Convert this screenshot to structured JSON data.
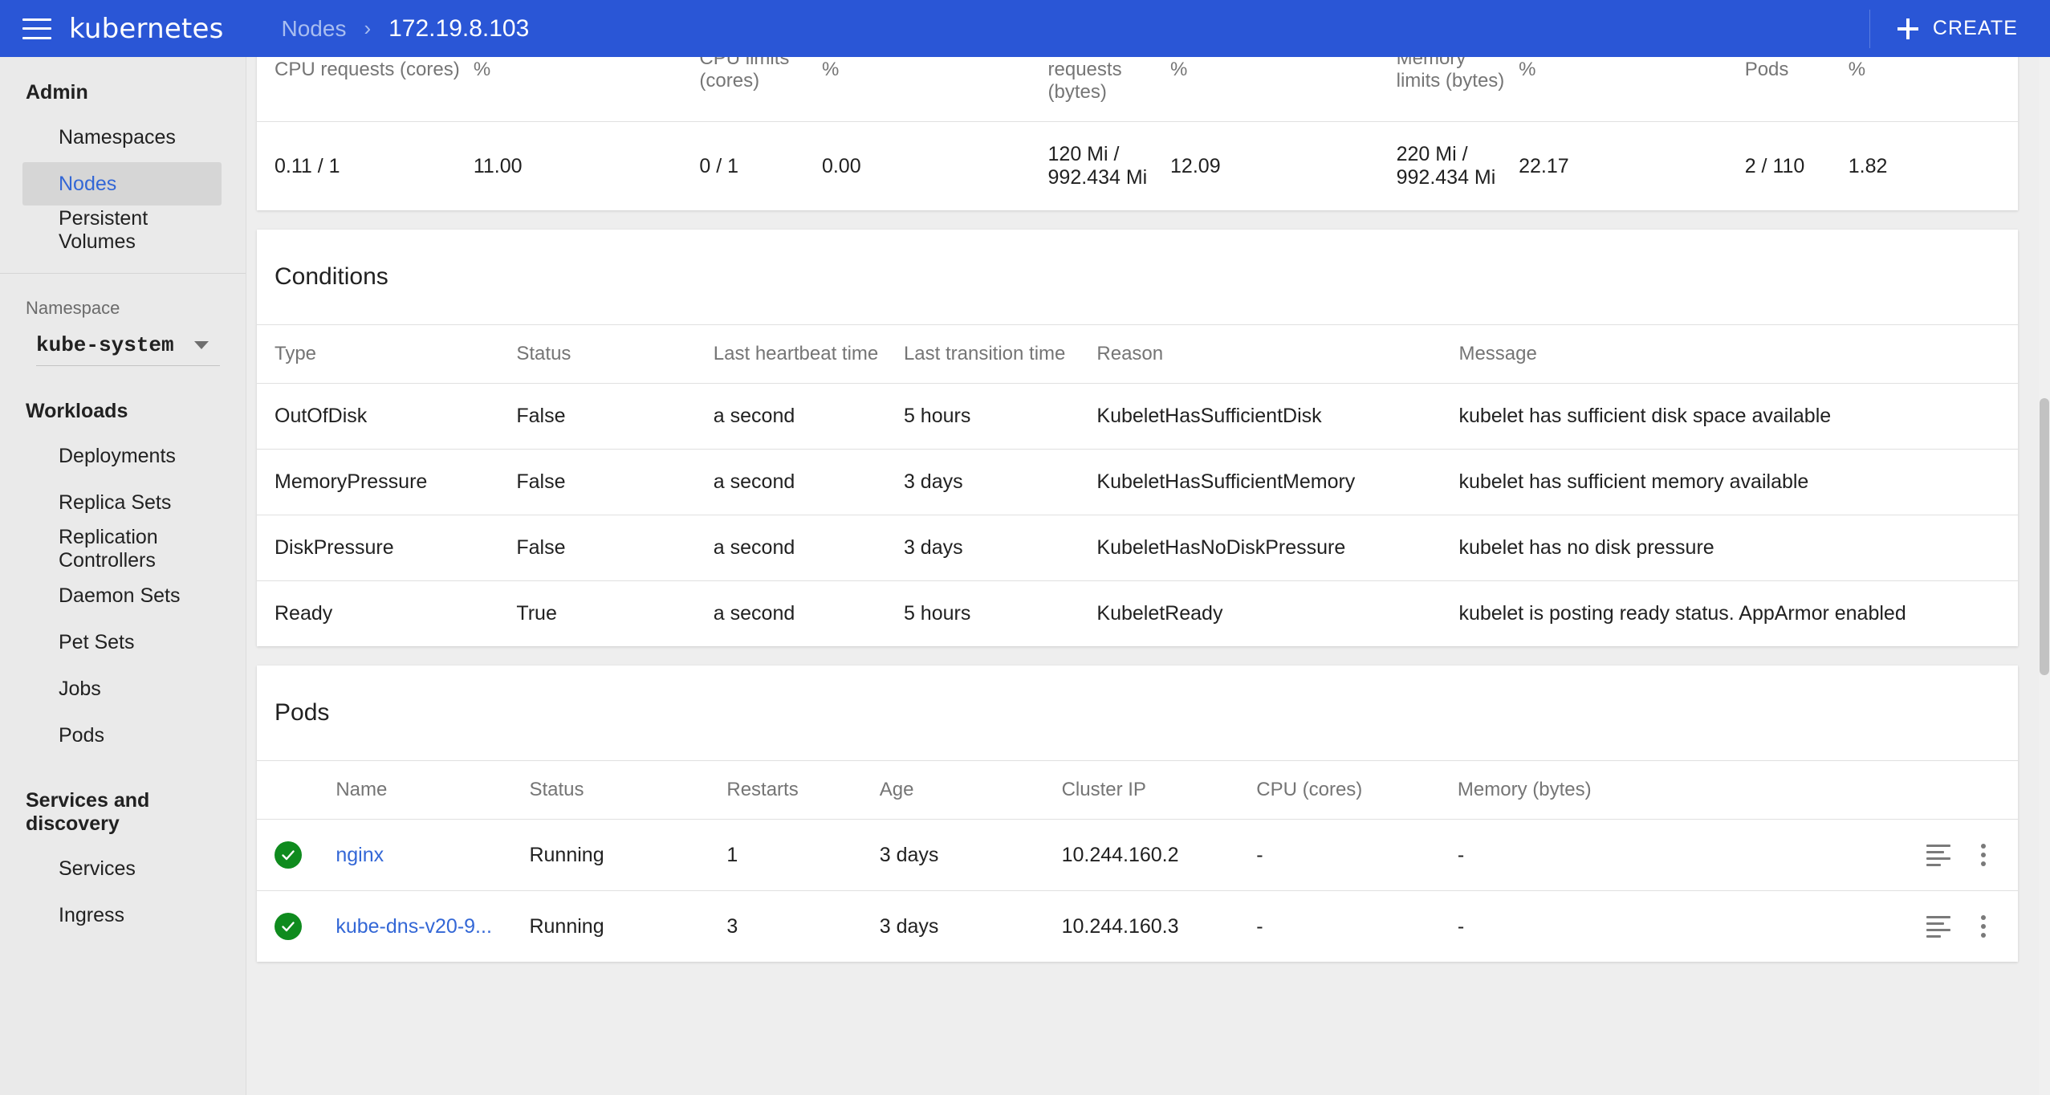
{
  "topbar": {
    "brand": "kubernetes",
    "menu_icon": "hamburger-icon",
    "breadcrumb_parent": "Nodes",
    "breadcrumb_sep": "›",
    "breadcrumb_current": "172.19.8.103",
    "create_label": "CREATE",
    "accent_color": "#2a56d6"
  },
  "sidebar": {
    "admin_title": "Admin",
    "admin_items": [
      {
        "label": "Namespaces",
        "selected": false
      },
      {
        "label": "Nodes",
        "selected": true
      },
      {
        "label": "Persistent Volumes",
        "selected": false
      }
    ],
    "namespace_label": "Namespace",
    "namespace_value": "kube-system",
    "workloads_title": "Workloads",
    "workload_items": [
      {
        "label": "Deployments"
      },
      {
        "label": "Replica Sets"
      },
      {
        "label": "Replication Controllers"
      },
      {
        "label": "Daemon Sets"
      },
      {
        "label": "Pet Sets"
      },
      {
        "label": "Jobs"
      },
      {
        "label": "Pods"
      }
    ],
    "services_title": "Services and discovery",
    "service_items": [
      {
        "label": "Services"
      },
      {
        "label": "Ingress"
      }
    ]
  },
  "metrics": {
    "headers": [
      "CPU requests (cores)",
      "%",
      "CPU limits (cores)",
      "%",
      "Memory requests (bytes)",
      "%",
      "Memory limits (bytes)",
      "%",
      "Pods",
      "%"
    ],
    "row": [
      "0.11 / 1",
      "11.00",
      "0 / 1",
      "0.00",
      "120 Mi / 992.434 Mi",
      "12.09",
      "220 Mi / 992.434 Mi",
      "22.17",
      "2 / 110",
      "1.82"
    ]
  },
  "conditions": {
    "title": "Conditions",
    "headers": [
      "Type",
      "Status",
      "Last heartbeat time",
      "Last transition time",
      "Reason",
      "Message"
    ],
    "rows": [
      {
        "type": "OutOfDisk",
        "status": "False",
        "heartbeat": "a second",
        "transition": "5 hours",
        "reason": "KubeletHasSufficientDisk",
        "message": "kubelet has sufficient disk space available"
      },
      {
        "type": "MemoryPressure",
        "status": "False",
        "heartbeat": "a second",
        "transition": "3 days",
        "reason": "KubeletHasSufficientMemory",
        "message": "kubelet has sufficient memory available"
      },
      {
        "type": "DiskPressure",
        "status": "False",
        "heartbeat": "a second",
        "transition": "3 days",
        "reason": "KubeletHasNoDiskPressure",
        "message": "kubelet has no disk pressure"
      },
      {
        "type": "Ready",
        "status": "True",
        "heartbeat": "a second",
        "transition": "5 hours",
        "reason": "KubeletReady",
        "message": "kubelet is posting ready status. AppArmor enabled"
      }
    ]
  },
  "pods": {
    "title": "Pods",
    "headers": [
      "",
      "Name",
      "Status",
      "Restarts",
      "Age",
      "Cluster IP",
      "CPU (cores)",
      "Memory (bytes)"
    ],
    "rows": [
      {
        "status_icon": "check-circle-icon",
        "name": "nginx",
        "status": "Running",
        "restarts": "1",
        "age": "3 days",
        "cluster_ip": "10.244.160.2",
        "cpu": "-",
        "memory": "-"
      },
      {
        "status_icon": "check-circle-icon",
        "name": "kube-dns-v20-9...",
        "status": "Running",
        "restarts": "3",
        "age": "3 days",
        "cluster_ip": "10.244.160.3",
        "cpu": "-",
        "memory": "-"
      }
    ],
    "status_ok_color": "#0f8b1e",
    "link_color": "#3367d6"
  }
}
